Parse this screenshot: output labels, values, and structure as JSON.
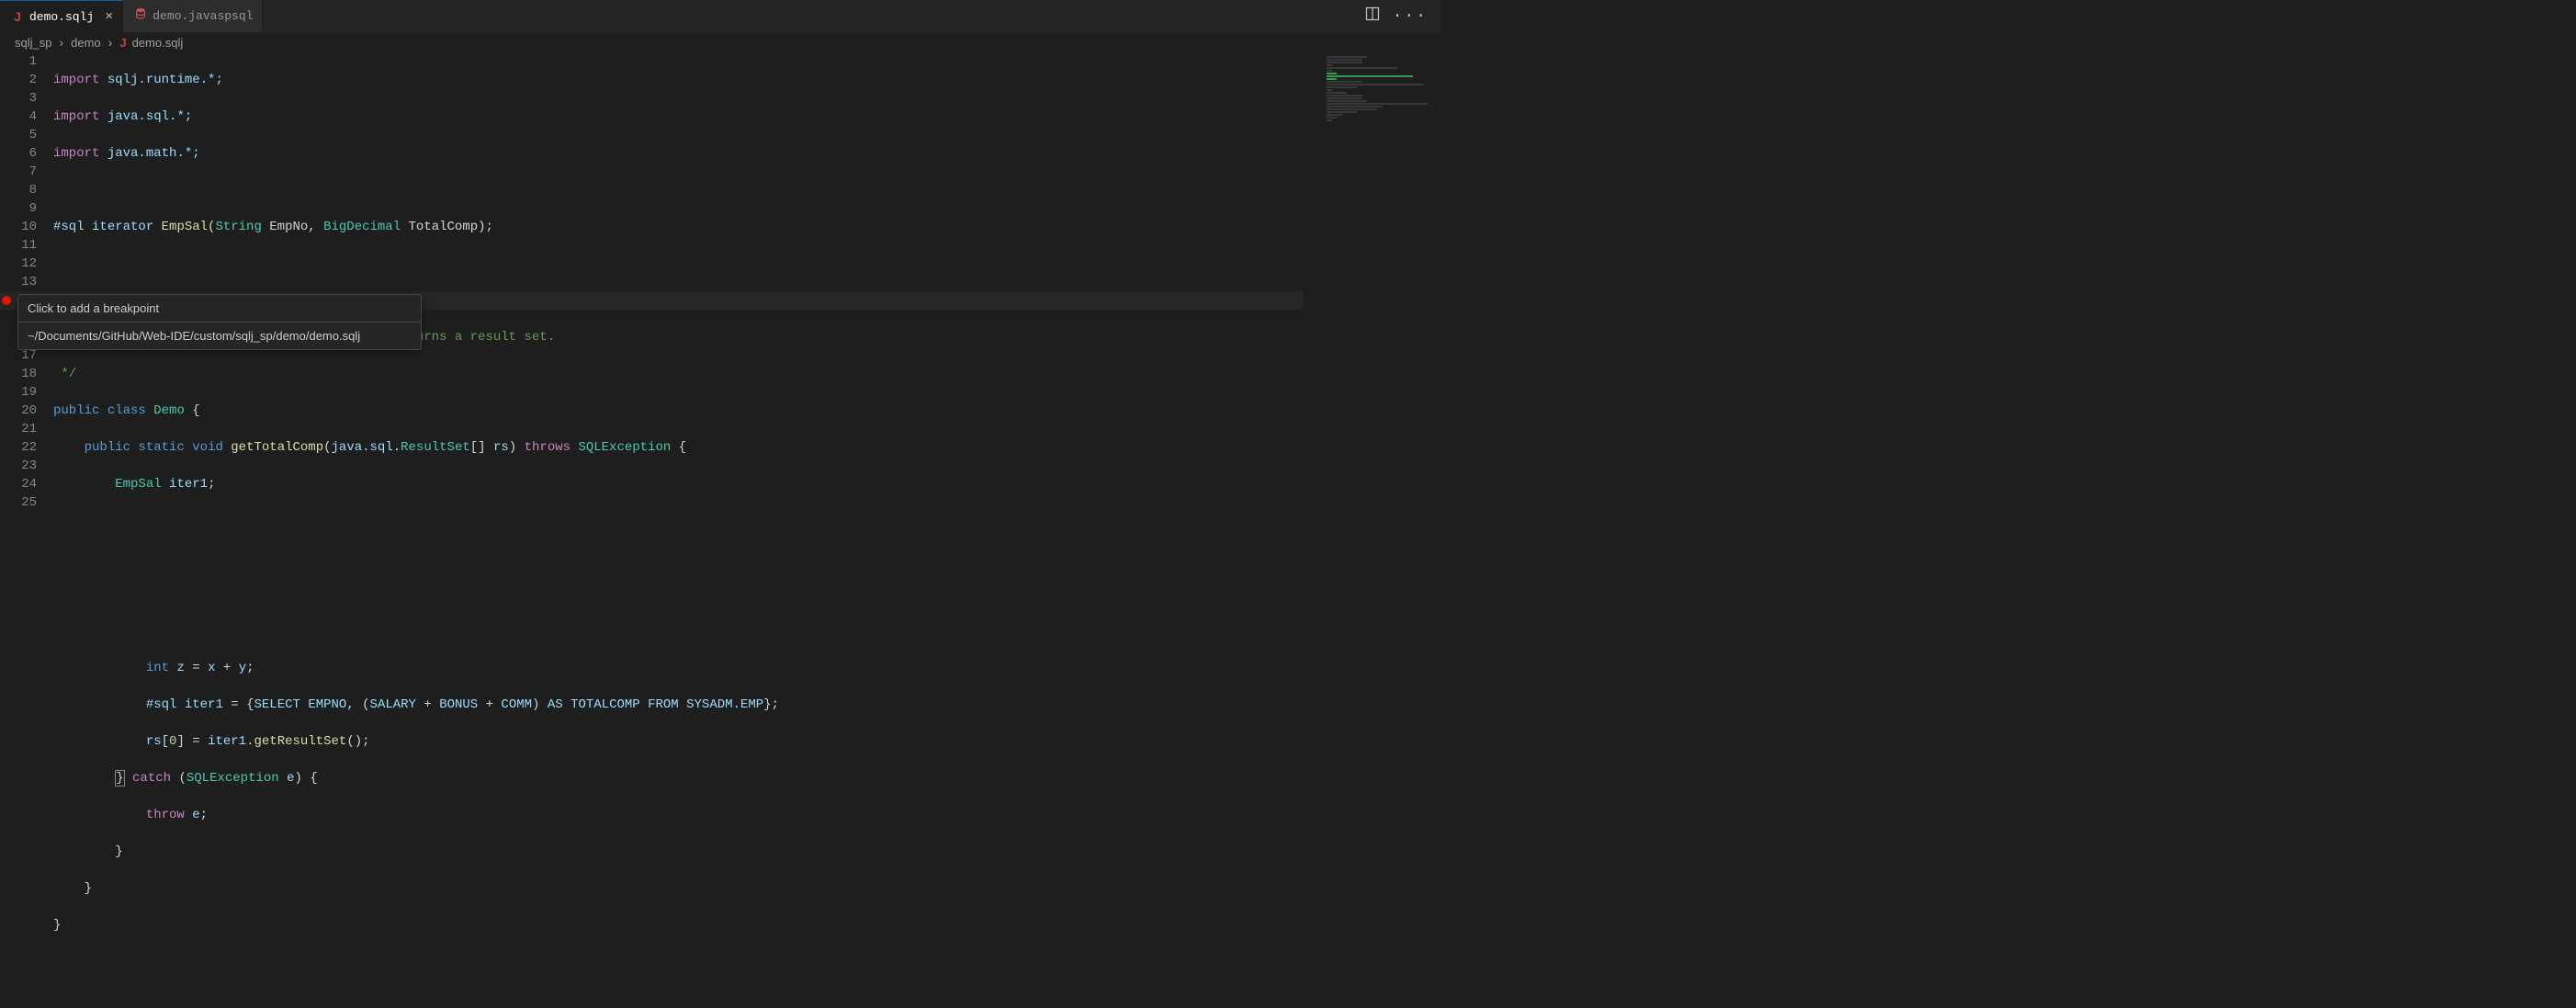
{
  "tabs": [
    {
      "icon": "J",
      "label": "demo.sqlj",
      "active": true,
      "closable": true
    },
    {
      "icon": "DB",
      "label": "demo.javaspsql",
      "active": false,
      "closable": false
    }
  ],
  "breadcrumb": {
    "parts": [
      "sqlj_sp",
      "demo",
      "demo.sqlj"
    ]
  },
  "tooltip": {
    "title": "Click to add a breakpoint",
    "path": "~/Documents/GitHub/Web-IDE/custom/sqlj_sp/demo/demo.sqlj"
  },
  "breakpoint_line": 14,
  "code_lines": 25,
  "code": {
    "l1": {
      "import": "import",
      "pkg": "sqlj.runtime.*;"
    },
    "l2": {
      "import": "import",
      "pkg": "java.sql.*;"
    },
    "l3": {
      "import": "import",
      "pkg": "java.math.*;"
    },
    "l5": {
      "hash": "#sql",
      "iterator": "iterator",
      "name": "EmpSal(",
      "t1": "String",
      "p1": " EmpNo, ",
      "t2": "BigDecimal",
      "p2": " TotalComp);"
    },
    "l7": {
      "c": "/**"
    },
    "l8": {
      "c": " * A sample SQLJ Java stored procedure that returns a result set."
    },
    "l9": {
      "c": " */"
    },
    "l10": {
      "public": "public",
      "class": "class",
      "name": "Demo",
      "brace": "{"
    },
    "l11": {
      "public": "public",
      "static": "static",
      "void": "void",
      "fn": "getTotalComp",
      "open": "(",
      "pkg": "java.sql.",
      "rs": "ResultSet",
      "arr": "[]",
      "var": "rs",
      "close": ")",
      "throws": "throws",
      "exc": "SQLException",
      "brace": "{"
    },
    "l12": {
      "type": "EmpSal",
      "var": "iter1",
      "semi": ";"
    },
    "l17": {
      "int": "int",
      "var": "z",
      "eq": "=",
      "x": "x",
      "plus": "+",
      "y": "y",
      "semi": ";"
    },
    "l18": {
      "hash": "#sql",
      "var": "iter1",
      "eq": "=",
      "open": "{",
      "sel": "SELECT",
      "c1": "EMPNO,",
      "paren": "(",
      "s": "SALARY",
      "p1": "+",
      "b": "BONUS",
      "p2": "+",
      "cm": "COMM",
      "cp": ")",
      "as": "AS",
      "tc": "TOTALCOMP",
      "from": "FROM",
      "tbl": "SYSADM.EMP",
      "close": "}",
      "semi": ";"
    },
    "l19": {
      "var": "rs",
      "idx": "[",
      "zero": "0",
      "idx2": "]",
      "eq": "=",
      "v2": "iter1",
      "dot": ".",
      "fn": "getResultSet",
      "paren": "()",
      "semi": ";"
    },
    "l20": {
      "brace": "}",
      "catch": "catch",
      "open": "(",
      "exc": "SQLException",
      "var": "e",
      "close": ")",
      "brace2": "{"
    },
    "l21": {
      "throw": "throw",
      "var": "e",
      "semi": ";"
    },
    "l22": {
      "brace": "}"
    },
    "l23": {
      "brace": "}"
    },
    "l24": {
      "brace": "}"
    }
  }
}
